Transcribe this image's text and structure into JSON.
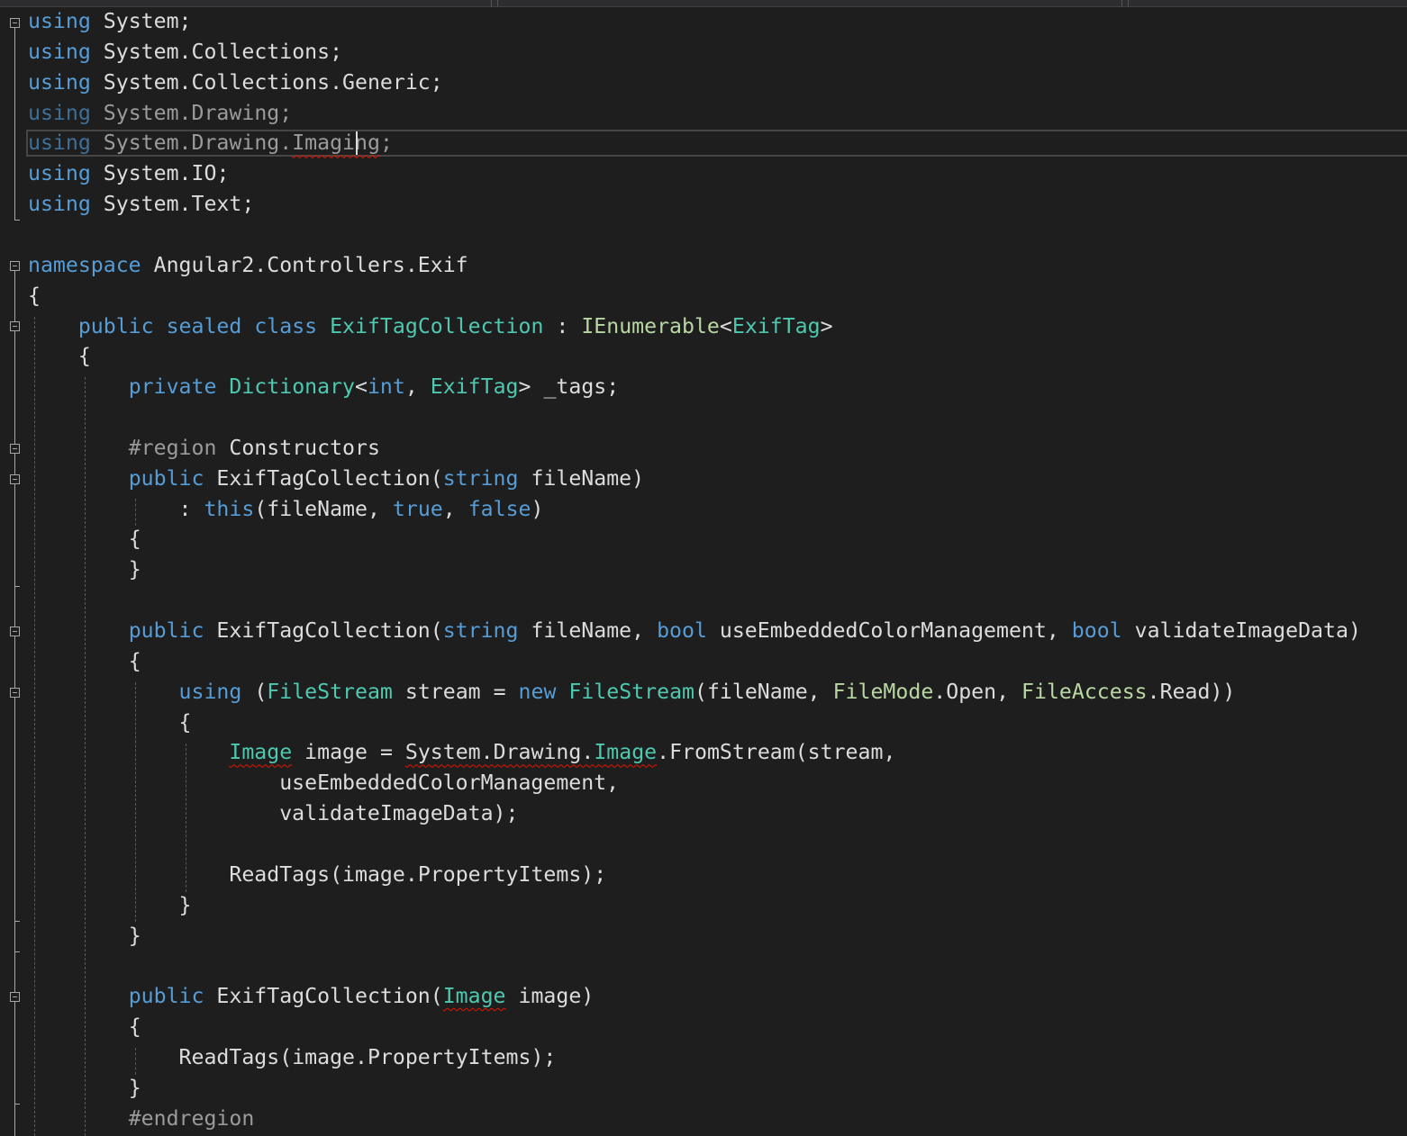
{
  "editor": {
    "language": "csharp",
    "current_line": 5,
    "colors": {
      "background": "#1e1e1e",
      "keyword": "#569cd6",
      "type": "#4ec9b0",
      "interface": "#b8d7a3",
      "plain": "#dcdcdc",
      "preprocessor": "#9b9b9b",
      "error_squiggle": "#e51400"
    },
    "lines": [
      "using System;",
      "using System.Collections;",
      "using System.Collections.Generic;",
      "using System.Drawing;",
      "using System.Drawing.Imaging;",
      "using System.IO;",
      "using System.Text;",
      "",
      "namespace Angular2.Controllers.Exif",
      "{",
      "    public sealed class ExifTagCollection : IEnumerable<ExifTag>",
      "    {",
      "        private Dictionary<int, ExifTag> _tags;",
      "",
      "        #region Constructors",
      "        public ExifTagCollection(string fileName)",
      "            : this(fileName, true, false)",
      "        {",
      "        }",
      "",
      "        public ExifTagCollection(string fileName, bool useEmbeddedColorManagement, bool validateImageData)",
      "        {",
      "            using (FileStream stream = new FileStream(fileName, FileMode.Open, FileAccess.Read))",
      "            {",
      "                Image image = System.Drawing.Image.FromStream(stream,",
      "                    useEmbeddedColorManagement,",
      "                    validateImageData);",
      "",
      "                ReadTags(image.PropertyItems);",
      "            }",
      "        }",
      "",
      "        public ExifTagCollection(Image image)",
      "        {",
      "            ReadTags(image.PropertyItems);",
      "        }",
      "        #endregion"
    ]
  }
}
